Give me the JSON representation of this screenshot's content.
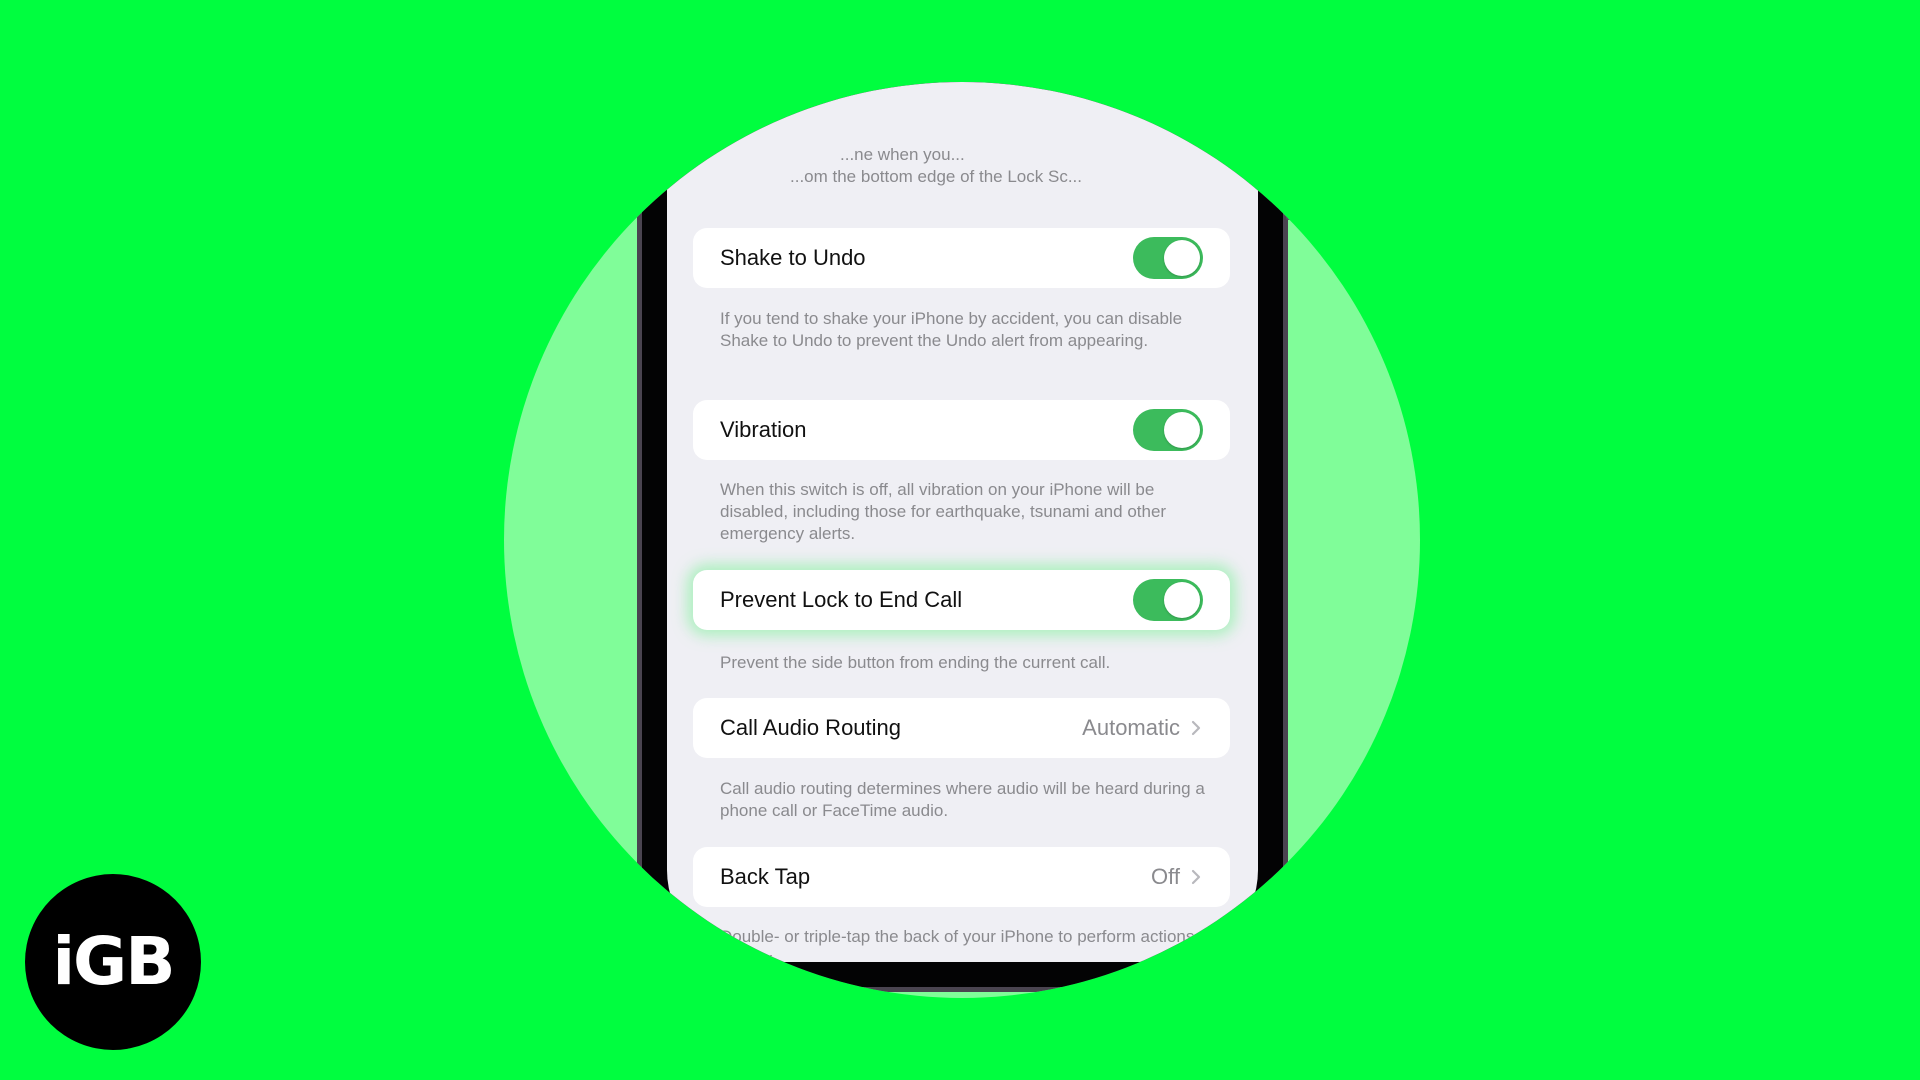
{
  "brand": {
    "logo_text": "iGB",
    "background_color": "#00fe3f",
    "halo_color": "#80fd99"
  },
  "screen": {
    "cut_off_text_line1": "...ne when you...",
    "cut_off_text_line2": "...om the bottom edge of the Lock Sc...",
    "toggle_on_color": "#3cbb5c",
    "settings": [
      {
        "title": "Shake to Undo",
        "control": "toggle",
        "state": "on",
        "footer": "If you tend to shake your iPhone by accident, you can disable Shake to Undo to prevent the Undo alert from appearing."
      },
      {
        "title": "Vibration",
        "control": "toggle",
        "state": "on",
        "footer": "When this switch is off, all vibration on your iPhone will be disabled, including those for earthquake, tsunami and other emergency alerts."
      },
      {
        "title": "Prevent Lock to End Call",
        "control": "toggle",
        "state": "on",
        "highlighted": true,
        "footer": "Prevent the side button from ending the current call."
      },
      {
        "title": "Call Audio Routing",
        "control": "disclosure",
        "value": "Automatic",
        "footer": "Call audio routing determines where audio will be heard during a phone call or FaceTime audio."
      },
      {
        "title": "Back Tap",
        "control": "disclosure",
        "value": "Off",
        "footer": "Double- or triple-tap the back of your iPhone to perform actions quickly."
      }
    ]
  }
}
